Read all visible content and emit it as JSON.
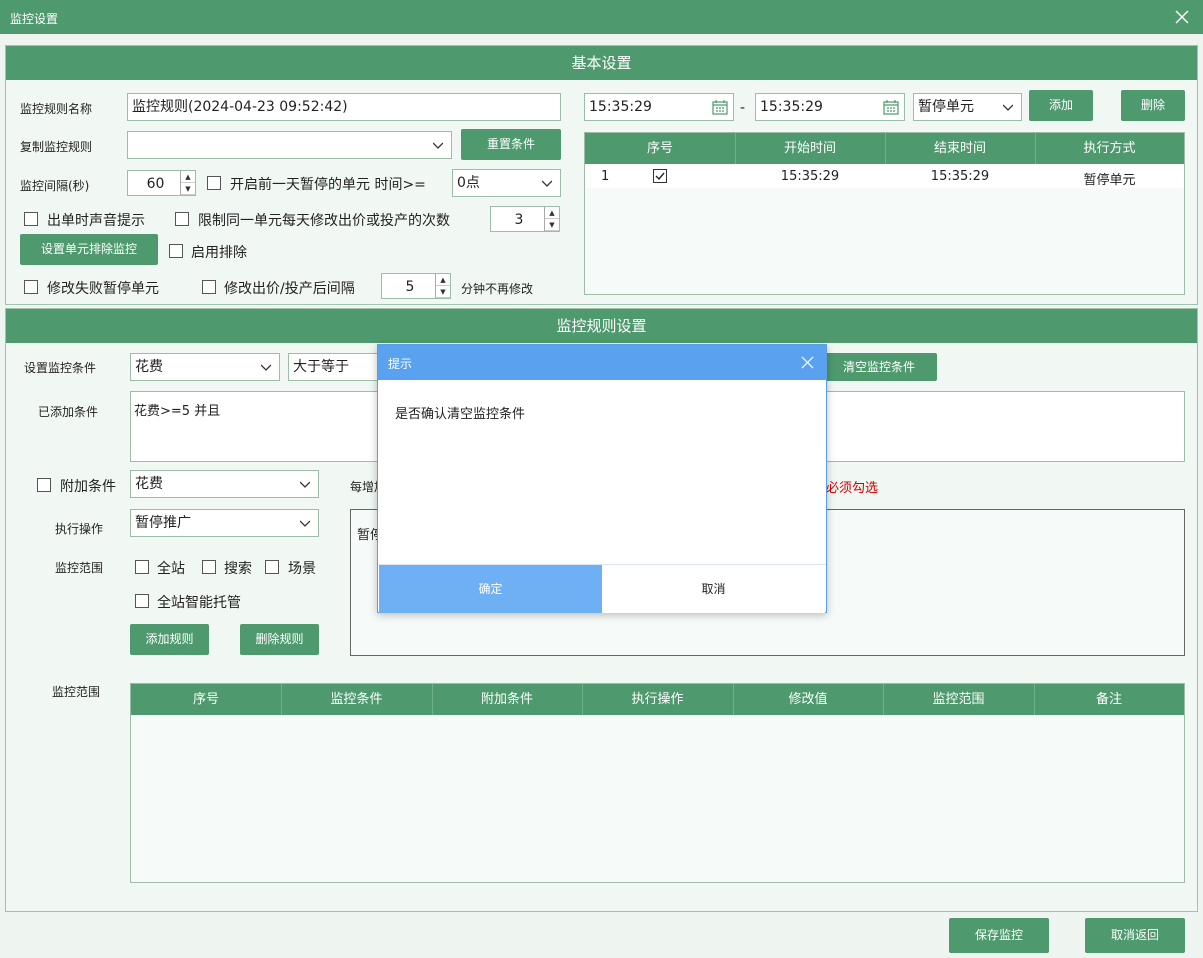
{
  "window": {
    "title": "监控设置"
  },
  "basic": {
    "header": "基本设置",
    "rule_name_label": "监控规则名称",
    "rule_name_value": "监控规则(2024-04-23 09:52:42)",
    "copy_rule_label": "复制监控规则",
    "copy_rule_value": "",
    "reset_button": "重置条件",
    "interval_label": "监控间隔(秒)",
    "interval_value": "60",
    "open_paused_label": "开启前一天暂停的单元 时间>=",
    "time_select": "0点",
    "sound_label": "出单时声音提示",
    "limit_label": "限制同一单元每天修改出价或投产的次数",
    "limit_value": "3",
    "exclude_button": "设置单元排除监控",
    "enable_exclude_label": "启用排除",
    "fail_pause_label": "修改失败暂停单元",
    "interval_after_label": "修改出价/投产后间隔",
    "interval_after_value": "5",
    "interval_after_suffix": "分钟不再修改",
    "start_time": "15:35:29",
    "dash": "-",
    "end_time": "15:35:29",
    "mode_select": "暂停单元",
    "add_button": "添加",
    "delete_button": "删除",
    "time_table": {
      "columns": [
        "序号",
        "开始时间",
        "结束时间",
        "执行方式"
      ],
      "row": {
        "index": "1",
        "start": "15:35:29",
        "end": "15:35:29",
        "mode": "暂停单元"
      }
    }
  },
  "rules": {
    "header": "监控规则设置",
    "condition_label": "设置监控条件",
    "condition_field": "花费",
    "condition_op": "大于等于",
    "clear_button": "清空监控条件",
    "added_label": "已添加条件",
    "added_text": "花费>=5 并且",
    "extra_label": "附加条件",
    "extra_field": "花费",
    "per_add_text": "每增加",
    "must_check_text": "必须勾选",
    "action_label": "执行操作",
    "action_value": "暂停推广",
    "action_box_text": "暂停",
    "scope_label": "监控范围",
    "scope_all": "全站",
    "scope_search": "搜索",
    "scope_scene": "场景",
    "scope_smart": "全站智能托管",
    "add_rule_button": "添加规则",
    "delete_rule_button": "删除规则",
    "bottom_scope_label": "监控范围",
    "rule_table": {
      "columns": [
        "序号",
        "监控条件",
        "附加条件",
        "执行操作",
        "修改值",
        "监控范围",
        "备注"
      ]
    }
  },
  "footer": {
    "save_button": "保存监控",
    "cancel_button": "取消返回"
  },
  "dialog": {
    "title": "提示",
    "message": "是否确认清空监控条件",
    "ok_button": "确定",
    "cancel_button": "取消"
  },
  "colors": {
    "green": "#4e9a6e",
    "dialog_blue": "#5aa2ef",
    "ok_blue": "#6fb0f5",
    "warning_red": "#d40000"
  }
}
